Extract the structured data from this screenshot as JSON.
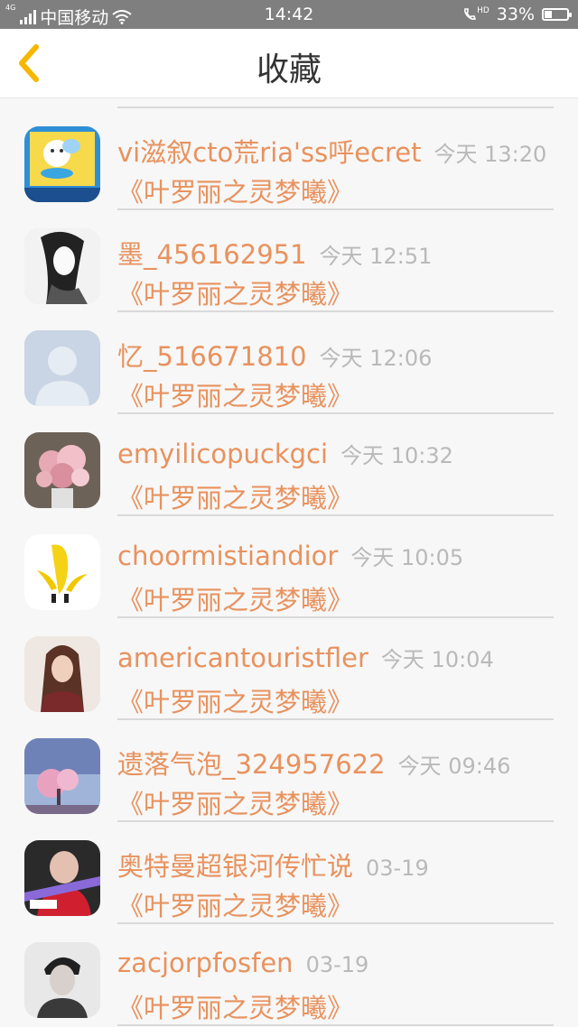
{
  "status_bar": {
    "network_type": "4G",
    "carrier": "中国移动",
    "time": "14:42",
    "volte": "HD",
    "battery_percent": "33%",
    "battery_level": 0.33
  },
  "nav": {
    "back_icon": "chevron-left-icon",
    "title": "收藏",
    "accent_color": "#f5b800"
  },
  "colors": {
    "name": "#e8925e",
    "time": "#b9b9b9",
    "divider": "#d9d9d9"
  },
  "favorites": [
    {
      "name": "vi滋叙cto荒ria'ss呼ecret",
      "time": "今天 13:20",
      "work": "《叶罗丽之灵梦曦》",
      "avatar": "gemini-cartoon-avatar"
    },
    {
      "name": "墨_456162951",
      "time": "今天 12:51",
      "work": "《叶罗丽之灵梦曦》",
      "avatar": "ink-sketch-avatar"
    },
    {
      "name": "忆_516671810",
      "time": "今天 12:06",
      "work": "《叶罗丽之灵梦曦》",
      "avatar": "default-person-avatar"
    },
    {
      "name": "emyilicopuckgci",
      "time": "今天 10:32",
      "work": "《叶罗丽之灵梦曦》",
      "avatar": "flower-bouquet-avatar"
    },
    {
      "name": "choormistiandior",
      "time": "今天 10:05",
      "work": "《叶罗丽之灵梦曦》",
      "avatar": "banana-avatar"
    },
    {
      "name": "americantouristfler",
      "time": "今天 10:04",
      "work": "《叶罗丽之灵梦曦》",
      "avatar": "girl-photo-avatar"
    },
    {
      "name": "遗落气泡_324957622",
      "time": "今天 09:46",
      "work": "《叶罗丽之灵梦曦》",
      "avatar": "cherry-tree-avatar"
    },
    {
      "name": "奥特曼超银河传忙说",
      "time": "03-19",
      "work": "《叶罗丽之灵梦曦》",
      "avatar": "red-portrait-avatar"
    },
    {
      "name": "zacjorpfosfen",
      "time": "03-19",
      "work": "《叶罗丽之灵梦曦》",
      "avatar": "boy-portrait-avatar"
    }
  ]
}
